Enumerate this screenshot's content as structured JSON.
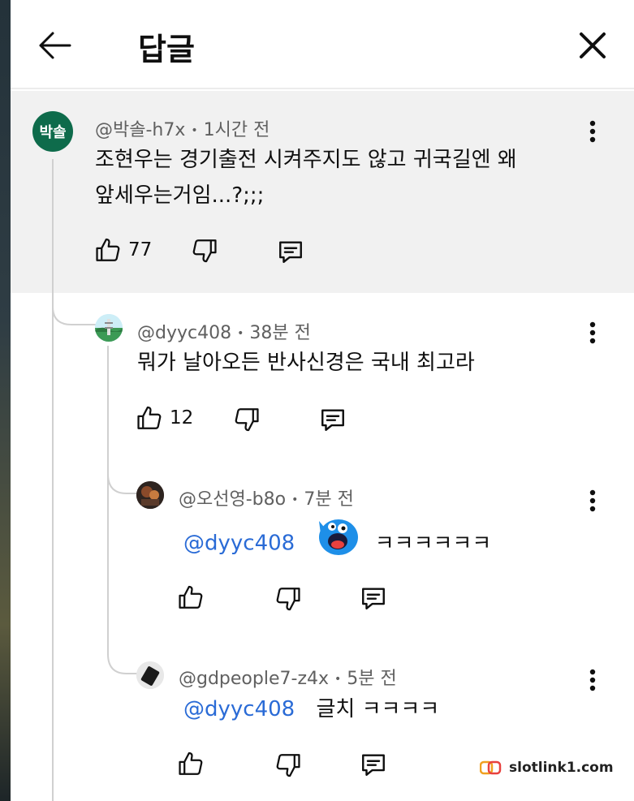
{
  "header": {
    "title": "답글"
  },
  "comments": [
    {
      "avatar_text": "박솔",
      "author": "@박솔-h7x",
      "sep": "•",
      "time": "1시간 전",
      "text_line1": "조현우는 경기출전 시켜주지도 않고 귀국길엔 왜",
      "text_line2": "앞세우는거임...?;;;",
      "likes": "77"
    },
    {
      "author": "@dyyc408",
      "sep": "•",
      "time": "38분 전",
      "text_line1": "뭐가 날아오든 반사신경은 국내 최고라",
      "likes": "12"
    },
    {
      "author": "@오선영-b8o",
      "sep": "•",
      "time": "7분 전",
      "mention": "@dyyc408",
      "text": "ㅋㅋㅋㅋㅋㅋ",
      "likes": ""
    },
    {
      "author": "@gdpeople7-z4x",
      "sep": "•",
      "time": "5분 전",
      "mention": "@dyyc408",
      "text": "글치 ㅋㅋㅋㅋ",
      "likes": ""
    }
  ],
  "watermark": {
    "text": "slotlink1.com"
  },
  "colors": {
    "mention": "#2a6bd6",
    "avatar_green": "#0e6b4b",
    "highlight_bg": "#f1f1f1"
  }
}
